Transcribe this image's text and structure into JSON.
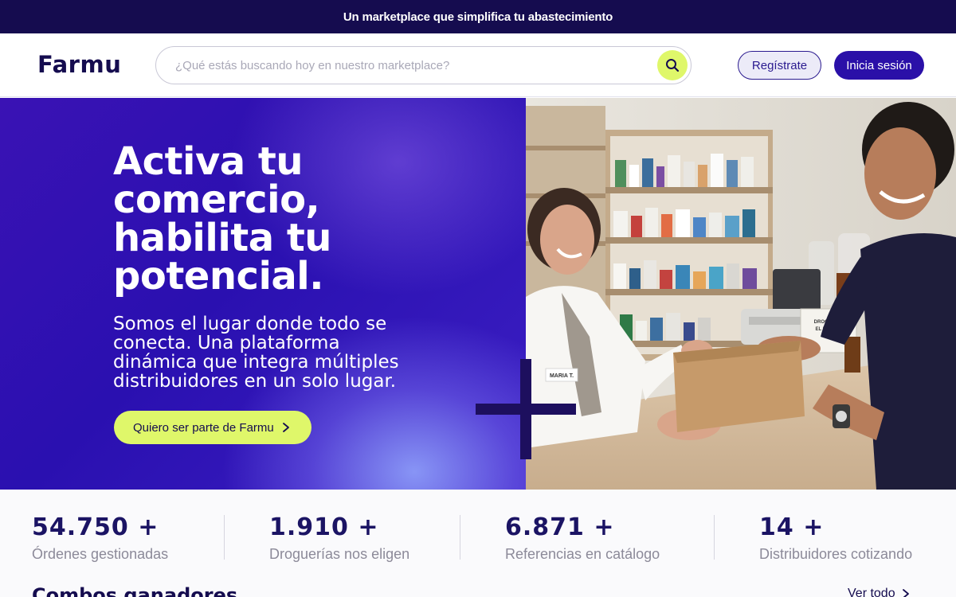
{
  "topbar": {
    "text": "Un marketplace que simplifica tu abastecimiento"
  },
  "header": {
    "logo": "Farmu",
    "search_placeholder": "¿Qué estás buscando hoy en nuestro marketplace?",
    "register_label": "Regístrate",
    "login_label": "Inicia sesión"
  },
  "hero": {
    "title": "Activa tu comercio, habilita tu potencial.",
    "subtitle": "Somos el lugar donde todo se conecta. Una plataforma dinámica que integra múltiples distribuidores en un solo lugar.",
    "cta_label": "Quiero ser parte de Farmu",
    "photo_texts": {
      "name_tag": "MARIA T.",
      "sign": "DROGUERÍA EL BARRIO"
    }
  },
  "stats": [
    {
      "value": "54.750 +",
      "label": "Órdenes gestionadas"
    },
    {
      "value": "1.910 +",
      "label": "Droguerías nos eligen"
    },
    {
      "value": "6.871 +",
      "label": "Referencias en catálogo"
    },
    {
      "value": "14 +",
      "label": "Distribuidores cotizando"
    }
  ],
  "section": {
    "title": "Combos ganadores",
    "see_all": "Ver todo"
  },
  "colors": {
    "topbar_bg": "#150c4f",
    "brand_purple": "#2a10a8",
    "accent_lime": "#dff76a",
    "stat_text": "#1b1464"
  }
}
